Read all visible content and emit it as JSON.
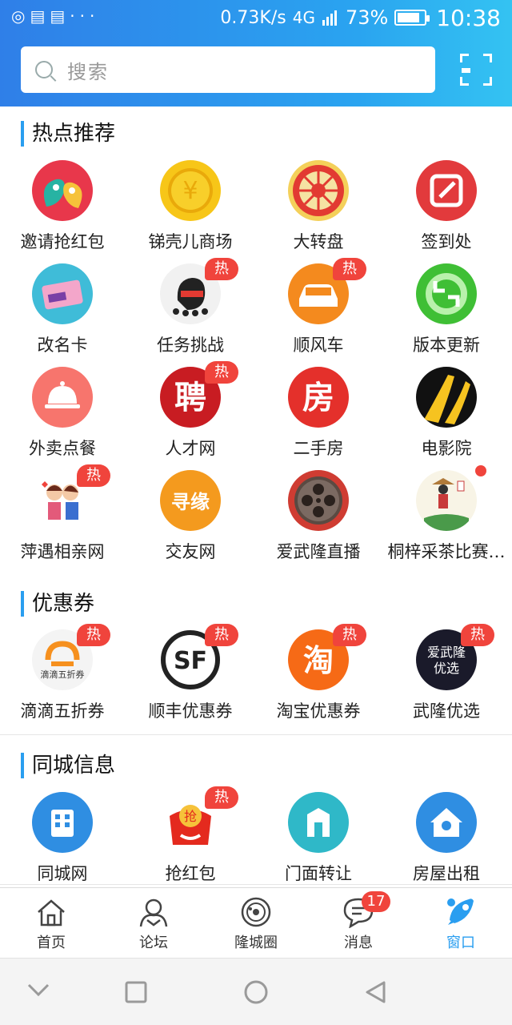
{
  "status_bar": {
    "left_icons": [
      "circle-icon",
      "message-icon",
      "message-icon",
      "more-icon"
    ],
    "net_speed": "0.73K/s",
    "network": "4G",
    "battery": "73%",
    "battery_level": 0.73,
    "time": "10:38"
  },
  "search": {
    "placeholder": "搜索"
  },
  "colors": {
    "header_start": "#2f7fe8",
    "header_end": "#34c3f2",
    "accent": "#2a9ef0",
    "hot": "#f0443c"
  },
  "sections": [
    {
      "title": "热点推荐",
      "items": [
        {
          "label": "邀请抢红包",
          "icon": "invite-redpacket-icon",
          "hot": false
        },
        {
          "label": "锑壳儿商场",
          "icon": "gold-coin-icon",
          "hot": false
        },
        {
          "label": "大转盘",
          "icon": "lucky-wheel-icon",
          "hot": false
        },
        {
          "label": "签到处",
          "icon": "checkin-edit-icon",
          "hot": false
        },
        {
          "label": "改名卡",
          "icon": "rename-card-icon",
          "hot": false
        },
        {
          "label": "任务挑战",
          "icon": "task-challenge-icon",
          "hot": true
        },
        {
          "label": "顺风车",
          "icon": "car-icon",
          "hot": true
        },
        {
          "label": "版本更新",
          "icon": "update-refresh-icon",
          "hot": false
        },
        {
          "label": "外卖点餐",
          "icon": "food-cloche-icon",
          "hot": false
        },
        {
          "label": "人才网",
          "icon": "recruit-icon",
          "hot": true
        },
        {
          "label": "二手房",
          "icon": "house-char-icon",
          "hot": false
        },
        {
          "label": "电影院",
          "icon": "cinema-road-icon",
          "hot": false
        },
        {
          "label": "萍遇相亲网",
          "icon": "couple-icon",
          "hot": true
        },
        {
          "label": "交友网",
          "icon": "friends-icon",
          "hot": false
        },
        {
          "label": "爱武隆直播",
          "icon": "film-reel-icon",
          "hot": false
        },
        {
          "label": "桐梓采茶比赛…",
          "icon": "tea-picking-icon",
          "hot": false,
          "dot": true
        }
      ]
    },
    {
      "title": "优惠券",
      "items": [
        {
          "label": "滴滴五折券",
          "icon": "didi-icon",
          "hot": true,
          "inner": "滴滴五折券"
        },
        {
          "label": "顺丰优惠券",
          "icon": "sf-express-icon",
          "hot": true
        },
        {
          "label": "淘宝优惠券",
          "icon": "taobao-icon",
          "hot": true
        },
        {
          "label": "武隆优选",
          "icon": "wulong-select-icon",
          "hot": true,
          "inner": "爱武隆优选"
        }
      ]
    },
    {
      "title": "同城信息",
      "items": [
        {
          "label": "同城网",
          "icon": "building-icon",
          "hot": false
        },
        {
          "label": "抢红包",
          "icon": "red-packet-icon",
          "hot": true,
          "inner": "抢"
        },
        {
          "label": "门面转让",
          "icon": "shop-door-icon",
          "hot": false
        },
        {
          "label": "房屋出租",
          "icon": "house-location-icon",
          "hot": false
        }
      ]
    }
  ],
  "hot_label": "热",
  "tabs": [
    {
      "label": "首页",
      "icon": "home-icon",
      "active": false
    },
    {
      "label": "论坛",
      "icon": "forum-icon",
      "active": false
    },
    {
      "label": "隆城圈",
      "icon": "circle-planet-icon",
      "active": false
    },
    {
      "label": "消息",
      "icon": "message-bubble-icon",
      "active": false,
      "badge": "17"
    },
    {
      "label": "窗口",
      "icon": "rocket-icon",
      "active": true
    }
  ],
  "nav": [
    {
      "icon": "chevron-down-icon"
    },
    {
      "icon": "recent-apps-icon"
    },
    {
      "icon": "home-circle-icon"
    },
    {
      "icon": "back-icon"
    }
  ]
}
